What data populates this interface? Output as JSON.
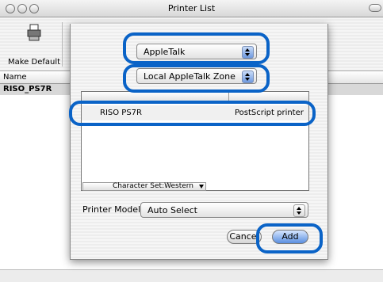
{
  "window": {
    "title": "Printer List"
  },
  "toolbar": {
    "make_default_label": "Make Default"
  },
  "printer_list": {
    "column_name": "Name",
    "rows": [
      "RISO_PS7R"
    ]
  },
  "sheet": {
    "connection_popup": "AppleTalk",
    "zone_popup": "Local AppleTalk Zone",
    "printer_row": {
      "name": "RISO PS7R",
      "type": "PostScript printer"
    },
    "character_set_label": "Character Set:Western",
    "printer_model_label": "Printer Model:",
    "printer_model_value": "Auto Select",
    "cancel_label": "Cancel",
    "add_label": "Add"
  },
  "colors": {
    "highlight": "#0a63c7",
    "add_button": "#5a8fe0"
  },
  "icons": {
    "window_controls": [
      "close-icon",
      "minimize-icon",
      "zoom-icon"
    ],
    "make_default": "printer-icon",
    "popup_arrows": "chevron-updown-icon"
  }
}
